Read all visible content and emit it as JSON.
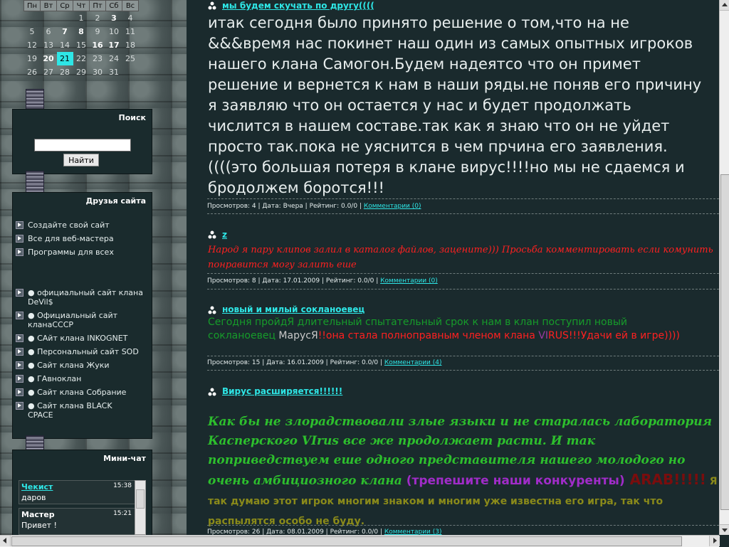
{
  "calendar": {
    "headers": [
      "Пн",
      "Вт",
      "Ср",
      "Чт",
      "Пт",
      "Сб",
      "Вс"
    ],
    "weeks": [
      [
        "",
        "",
        "",
        "1",
        "2",
        "3",
        "4"
      ],
      [
        "5",
        "6",
        "7",
        "8",
        "9",
        "10",
        "11"
      ],
      [
        "12",
        "13",
        "14",
        "15",
        "16",
        "17",
        "18"
      ],
      [
        "19",
        "20",
        "21",
        "22",
        "23",
        "24",
        "25"
      ],
      [
        "26",
        "27",
        "28",
        "29",
        "30",
        "31",
        ""
      ]
    ]
  },
  "search": {
    "title": "Поиск",
    "value": "",
    "button": "Найти"
  },
  "friends": {
    "title": "Друзья сайта",
    "links": [
      "Создайте свой сайт",
      "Все для веб-мастера",
      "Программы для всех"
    ],
    "clans": [
      "●  официальный сайт клана DeVil$",
      "●  Официальный сайт кланаСССР",
      "●  САйт клана INKOGNET",
      "●  Персональный сайт SOD",
      "●  Сайт клана Жуки",
      "●  ГАвноклан",
      "●  Сайт клана Собрание",
      "●  Сайт клана BLACK CPACE"
    ]
  },
  "chat": {
    "title": "Мини-чат",
    "messages": [
      {
        "user": "Чекист",
        "time": "15:38",
        "text": "даров"
      },
      {
        "user": "Мастер",
        "time": "15:21",
        "text": "Привет !"
      }
    ]
  },
  "posts": [
    {
      "title": "мы будем скучать по другу((((",
      "body": "итак сегодня было принято решение о том,что на не &&&время нас покинет наш один из самых опытных игроков нашего клана Самогон.Будем надеятсо что он примет решение и вернется к нам в наши ряды.не поняв его причину я заявляю что он остается у нас и будет продолжать числится в нашем составе.так как я знаю что он не уйдет просто так.пока не уяснится в чем прчина его заявления.((((это большая потеря в клане вирус!!!!но мы не сдаемся и бродолжем боротся!!!",
      "meta": "Просмотров: 4 | Дата: Вчера | Рейтинг: 0.0/0 | ",
      "comments": "Комментарии (0)"
    },
    {
      "title": "z",
      "body": "Народ я пару клипов залил в каталог файлов, зацените))) Просьба комментировать если комунить понравится могу залить еше",
      "meta": "Просмотров: 8 | Дата: 17.01.2009 | Рейтинг: 0.0/0 | ",
      "comments": "Комментарии (0)"
    },
    {
      "title": "новый и милый сокланоевец",
      "body_parts": [
        "Сегодня пройдЯ длительный  спытательный срок к нам в клан поступил новый сокланоевец ",
        "МарусЯ",
        "!!она стала полноправным членом клана ",
        "VI",
        "RUS!!!Удачи ей в игре))))"
      ],
      "meta": "Просмотров: 15 | Дата: 16.01.2009 | Рейтинг: 0.0/0 | ",
      "comments": "Комментарии (4)"
    },
    {
      "title": "Вирус расширяется!!!!!!",
      "body_parts": [
        "Как бы не злорадствовали злые языки и не старалась лаборатория Касперского VIrus все же продолжает расти. И так поприведствуем еше одного представителя нашего молодого но очень амбициозного клана ",
        "(трепешите наши конкуренты)",
        " ARAB!!!!!",
        " Я так думаю этот игрок многим знаком и многим уже известна его игра, так что распылятся  особо не буду."
      ],
      "meta": "Просмотров: 26 | Дата: 08.01.2009 | Рейтинг: 0.0/0 | ",
      "comments": "Комментарии (3)"
    }
  ]
}
